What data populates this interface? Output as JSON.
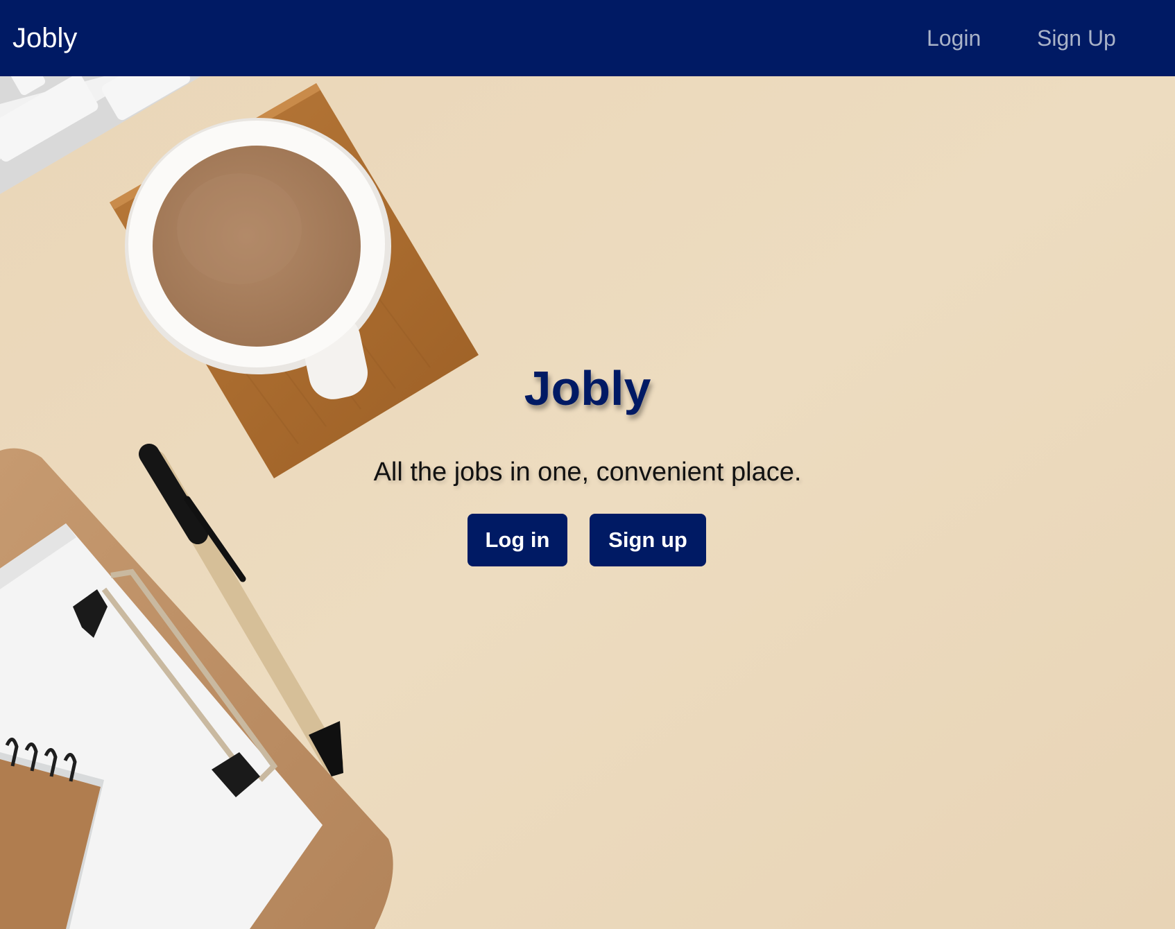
{
  "navbar": {
    "brand": "Jobly",
    "links": {
      "login": "Login",
      "signup": "Sign Up"
    },
    "background_color": "#001a64"
  },
  "hero": {
    "title": "Jobly",
    "tagline": "All the jobs in one, convenient place.",
    "buttons": {
      "login": "Log in",
      "signup": "Sign up"
    },
    "accent_color": "#001a64",
    "background_photo": "desk flat-lay with keyboard, coffee cup on wooden coaster, pen, clipboard and notebook"
  }
}
